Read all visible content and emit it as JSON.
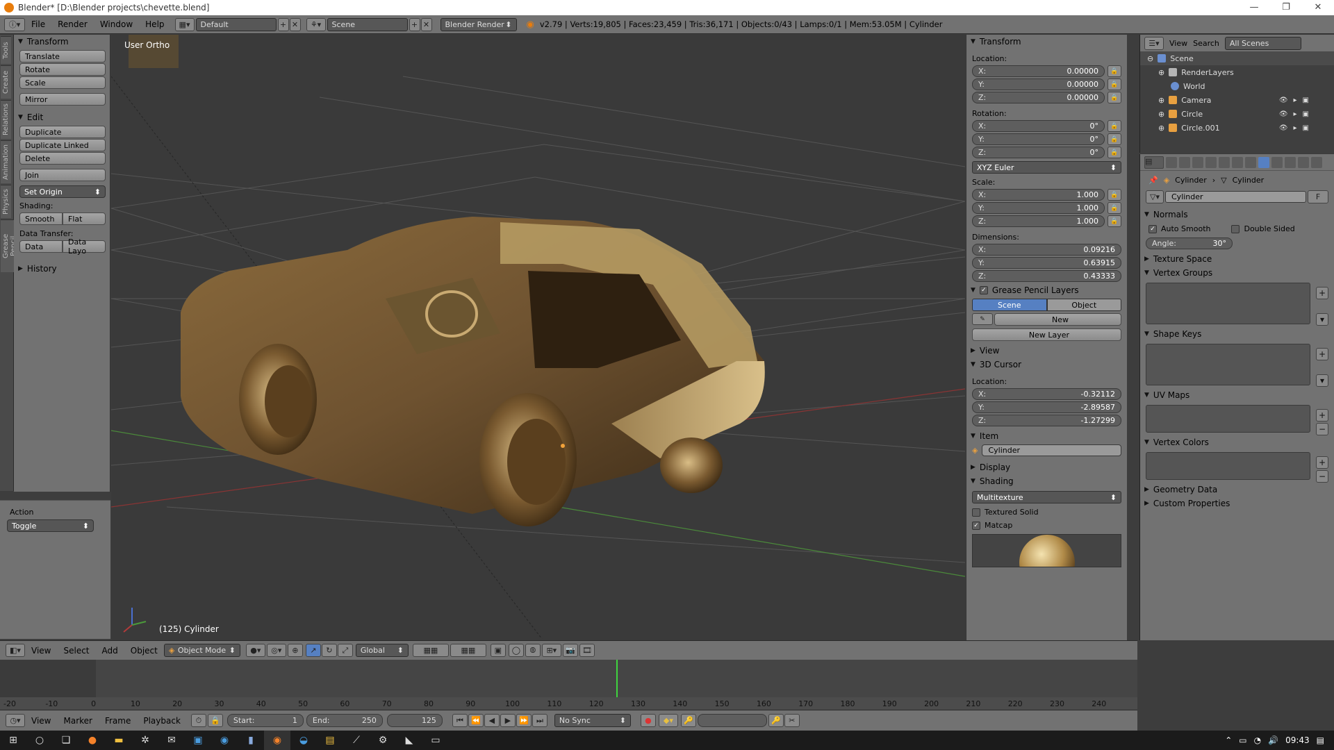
{
  "window": {
    "title": "Blender* [D:\\Blender projects\\chevette.blend]",
    "min": "—",
    "max": "❐",
    "close": "✕"
  },
  "info_header": {
    "menus": [
      "File",
      "Render",
      "Window",
      "Help"
    ],
    "layout": "Default",
    "scene": "Scene",
    "engine": "Blender Render",
    "stats": "v2.79 | Verts:19,805 | Faces:23,459 | Tris:36,171 | Objects:0/43 | Lamps:0/1 | Mem:53.05M | Cylinder"
  },
  "vertical_tabs": [
    "Tools",
    "Create",
    "Relations",
    "Animation",
    "Physics",
    "Grease Pencil"
  ],
  "toolshelf": {
    "transform": {
      "title": "Transform",
      "buttons": [
        "Translate",
        "Rotate",
        "Scale",
        "Mirror"
      ]
    },
    "edit": {
      "title": "Edit",
      "buttons": [
        "Duplicate",
        "Duplicate Linked",
        "Delete",
        "Join"
      ],
      "set_origin": "Set Origin",
      "shading_label": "Shading:",
      "smooth": "Smooth",
      "flat": "Flat",
      "data_transfer_label": "Data Transfer:",
      "data": "Data",
      "data_layout": "Data Layo"
    },
    "history": "History"
  },
  "operator": {
    "title": "Action",
    "value": "Toggle"
  },
  "viewport": {
    "view_label": "User Ortho",
    "object_label": "(125) Cylinder"
  },
  "npanel": {
    "transform_title": "Transform",
    "location_label": "Location:",
    "location": {
      "x": "0.00000",
      "y": "0.00000",
      "z": "0.00000"
    },
    "rotation_label": "Rotation:",
    "rotation": {
      "x": "0°",
      "y": "0°",
      "z": "0°"
    },
    "rotation_mode": "XYZ Euler",
    "scale_label": "Scale:",
    "scale": {
      "x": "1.000",
      "y": "1.000",
      "z": "1.000"
    },
    "dimensions_label": "Dimensions:",
    "dimensions": {
      "x": "0.09216",
      "y": "0.63915",
      "z": "0.43333"
    },
    "axis": {
      "x": "X:",
      "y": "Y:",
      "z": "Z:"
    },
    "grease_title": "Grease Pencil Layers",
    "tab_scene": "Scene",
    "tab_object": "Object",
    "new": "New",
    "new_layer": "New Layer",
    "view_title": "View",
    "cursor_title": "3D Cursor",
    "cursor_location_label": "Location:",
    "cursor": {
      "x": "-0.32112",
      "y": "-2.89587",
      "z": "-1.27299"
    },
    "item_title": "Item",
    "item_name": "Cylinder",
    "display_title": "Display",
    "shading_title": "Shading",
    "shading_mode": "Multitexture",
    "textured_solid": "Textured Solid",
    "matcap": "Matcap"
  },
  "outliner": {
    "view": "View",
    "search": "Search",
    "filter": "All Scenes",
    "rows": [
      {
        "label": "Scene",
        "color": "#6a8fd0"
      },
      {
        "label": "RenderLayers",
        "color": "#b5b5b5"
      },
      {
        "label": "World",
        "color": "#6a8fd0"
      },
      {
        "label": "Camera",
        "color": "#e8a040"
      },
      {
        "label": "Circle",
        "color": "#e8a040"
      },
      {
        "label": "Circle.001",
        "color": "#e8a040"
      }
    ]
  },
  "properties": {
    "crumb1": "Cylinder",
    "crumb2": "Cylinder",
    "mesh_name": "Cylinder",
    "fake": "F",
    "normals": "Normals",
    "auto_smooth": "Auto Smooth",
    "double_sided": "Double Sided",
    "angle_label": "Angle:",
    "angle": "30°",
    "texture_space": "Texture Space",
    "vertex_groups": "Vertex Groups",
    "shape_keys": "Shape Keys",
    "uv_maps": "UV Maps",
    "vertex_colors": "Vertex Colors",
    "geometry_data": "Geometry Data",
    "custom_properties": "Custom Properties"
  },
  "view3d_header": {
    "menus": [
      "View",
      "Select",
      "Add",
      "Object"
    ],
    "mode": "Object Mode",
    "orientation": "Global"
  },
  "timeline": {
    "ticks": [
      "-20",
      "-10",
      "0",
      "10",
      "20",
      "30",
      "40",
      "50",
      "60",
      "70",
      "80",
      "90",
      "100",
      "110",
      "120",
      "130",
      "140",
      "150",
      "160",
      "170",
      "180",
      "190",
      "200",
      "210",
      "220",
      "230",
      "240"
    ],
    "current_frame": 125,
    "menus": [
      "View",
      "Marker",
      "Frame",
      "Playback"
    ],
    "start_label": "Start:",
    "start": "1",
    "end_label": "End:",
    "end": "250",
    "frame": "125",
    "sync": "No Sync"
  },
  "taskbar": {
    "time": "09:43"
  },
  "colors": {
    "accent_blue": "#5680c2",
    "ui_gray": "#727272",
    "timeline_cursor": "#3fd43f"
  }
}
